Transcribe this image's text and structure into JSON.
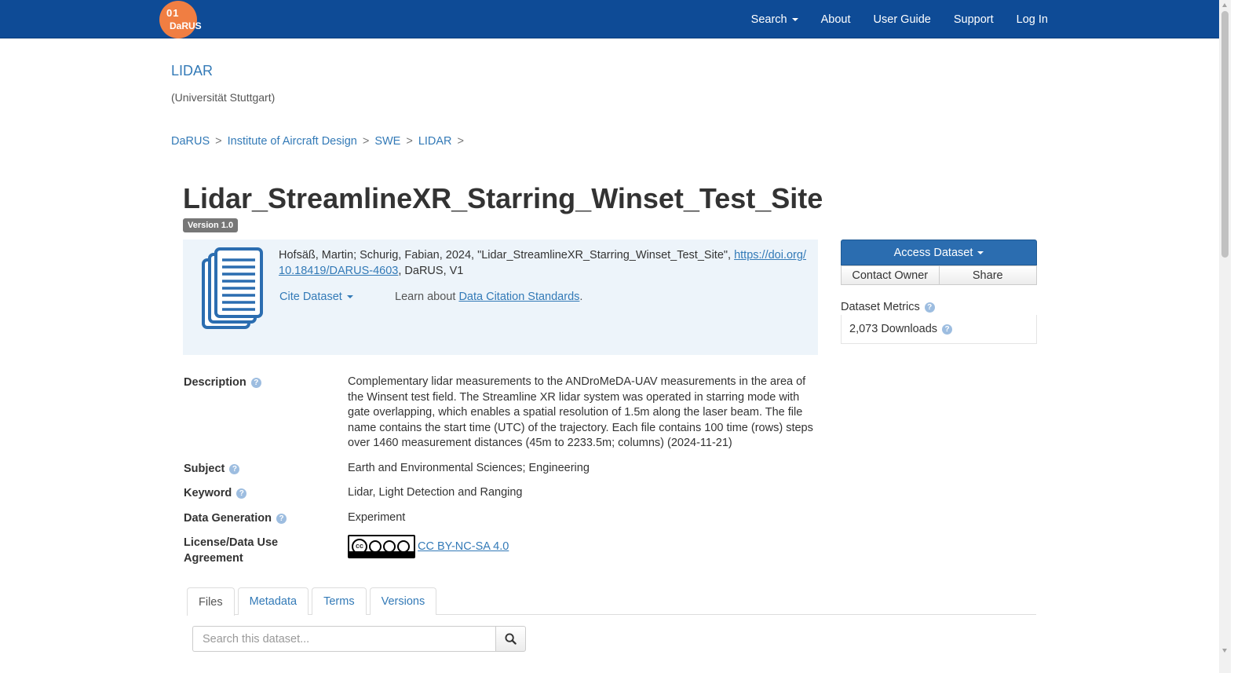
{
  "navbar": {
    "logo_text": "DaRUS",
    "logo_bits": "01",
    "items": [
      {
        "label": "Search",
        "dropdown": true
      },
      {
        "label": "About"
      },
      {
        "label": "User Guide"
      },
      {
        "label": "Support"
      },
      {
        "label": "Log In"
      }
    ],
    "color": "#0e4b96"
  },
  "dataverse": {
    "name": "LIDAR",
    "affiliation": "(Universität Stuttgart)"
  },
  "breadcrumb": [
    "DaRUS",
    "Institute of Aircraft Design",
    "SWE",
    "LIDAR"
  ],
  "breadcrumb_separator": ">",
  "dataset": {
    "title": "Lidar_StreamlineXR_Starring_Winset_Test_Site",
    "version_badge": "Version 1.0"
  },
  "citation": {
    "text_before": "Hofsäß, Martin; Schurig, Fabian, 2024, \"Lidar_StreamlineXR_Starring_Winset_Test_Site\", ",
    "doi_link": "https://doi.org/10.18419/DARUS-4603",
    "text_after": ", DaRUS, V1",
    "cite_dropdown": "Cite Dataset",
    "learn_prefix": "Learn about ",
    "learn_link": "Data Citation Standards",
    "learn_suffix": "."
  },
  "actions": {
    "access": "Access Dataset",
    "contact": "Contact Owner",
    "share": "Share"
  },
  "metrics": {
    "heading": "Dataset Metrics",
    "downloads": "2,073 Downloads"
  },
  "metadata": {
    "description_label": "Description",
    "description": "Complementary lidar measurements to the ANDroMeDA-UAV measurements in the area of the Winsent test field. The Streamline XR lidar system was operated in starring mode with gate overlapping, which enables a spatial resolution of 1.5m along the laser beam. The file name contains the start time (UTC) of the trajectory. Each file contains 100 time (rows) steps over 1460 measurement distances (45m to 2233.5m; columns) (2024-11-21)",
    "subject_label": "Subject",
    "subject": "Earth and Environmental Sciences; Engineering",
    "keyword_label": "Keyword",
    "keyword": "Lidar, Light Detection and Ranging",
    "datagen_label": "Data Generation",
    "datagen": "Experiment",
    "license_label": "License/Data Use Agreement",
    "license_badge_text": "BY NC SA",
    "license": "CC BY-NC-SA 4.0"
  },
  "tabs": [
    "Files",
    "Metadata",
    "Terms",
    "Versions"
  ],
  "file_search": {
    "placeholder": "Search this dataset..."
  }
}
